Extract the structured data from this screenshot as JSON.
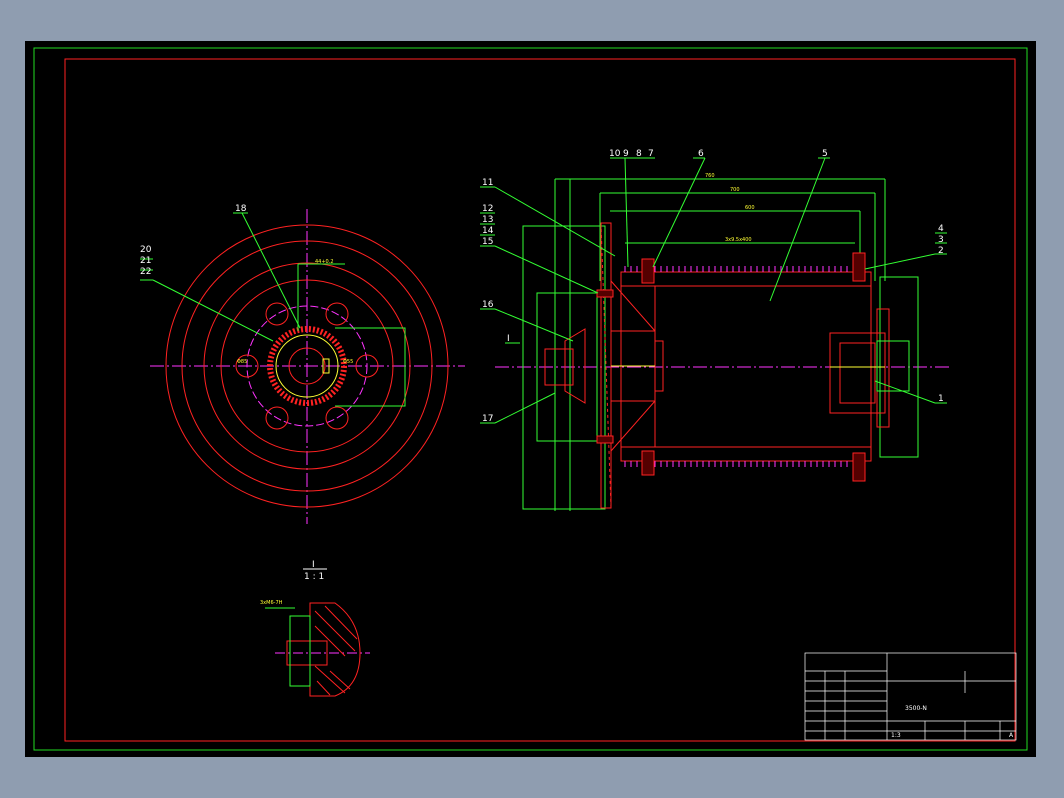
{
  "drawing": {
    "colors": {
      "background": "#000000",
      "frame": "#22dd22",
      "border": "#ff2222",
      "centerline": "#ff33ff",
      "dimension": "#33ff33",
      "yellow": "#ffff33",
      "window": "#8f9db0"
    },
    "balloons": [
      {
        "id": "b18",
        "text": "18"
      },
      {
        "id": "b20",
        "text": "20"
      },
      {
        "id": "b21",
        "text": "21"
      },
      {
        "id": "b22",
        "text": "22"
      },
      {
        "id": "b11",
        "text": "11"
      },
      {
        "id": "b12",
        "text": "12"
      },
      {
        "id": "b13",
        "text": "13"
      },
      {
        "id": "b14",
        "text": "14"
      },
      {
        "id": "b15",
        "text": "15"
      },
      {
        "id": "b16",
        "text": "16"
      },
      {
        "id": "b17",
        "text": "17"
      },
      {
        "id": "b10",
        "text": "10"
      },
      {
        "id": "b9",
        "text": "9"
      },
      {
        "id": "b8",
        "text": "8"
      },
      {
        "id": "b7",
        "text": "7"
      },
      {
        "id": "b6",
        "text": "6"
      },
      {
        "id": "b5",
        "text": "5"
      },
      {
        "id": "b4",
        "text": "4"
      },
      {
        "id": "b3",
        "text": "3"
      },
      {
        "id": "b2",
        "text": "2"
      },
      {
        "id": "b1",
        "text": "1"
      }
    ],
    "detail_view": {
      "marker": "I",
      "title": "I",
      "scale": "1 : 1"
    },
    "title_block": {
      "drawing_number": "3500-N",
      "scale": "1:3",
      "sheet": "A"
    }
  }
}
